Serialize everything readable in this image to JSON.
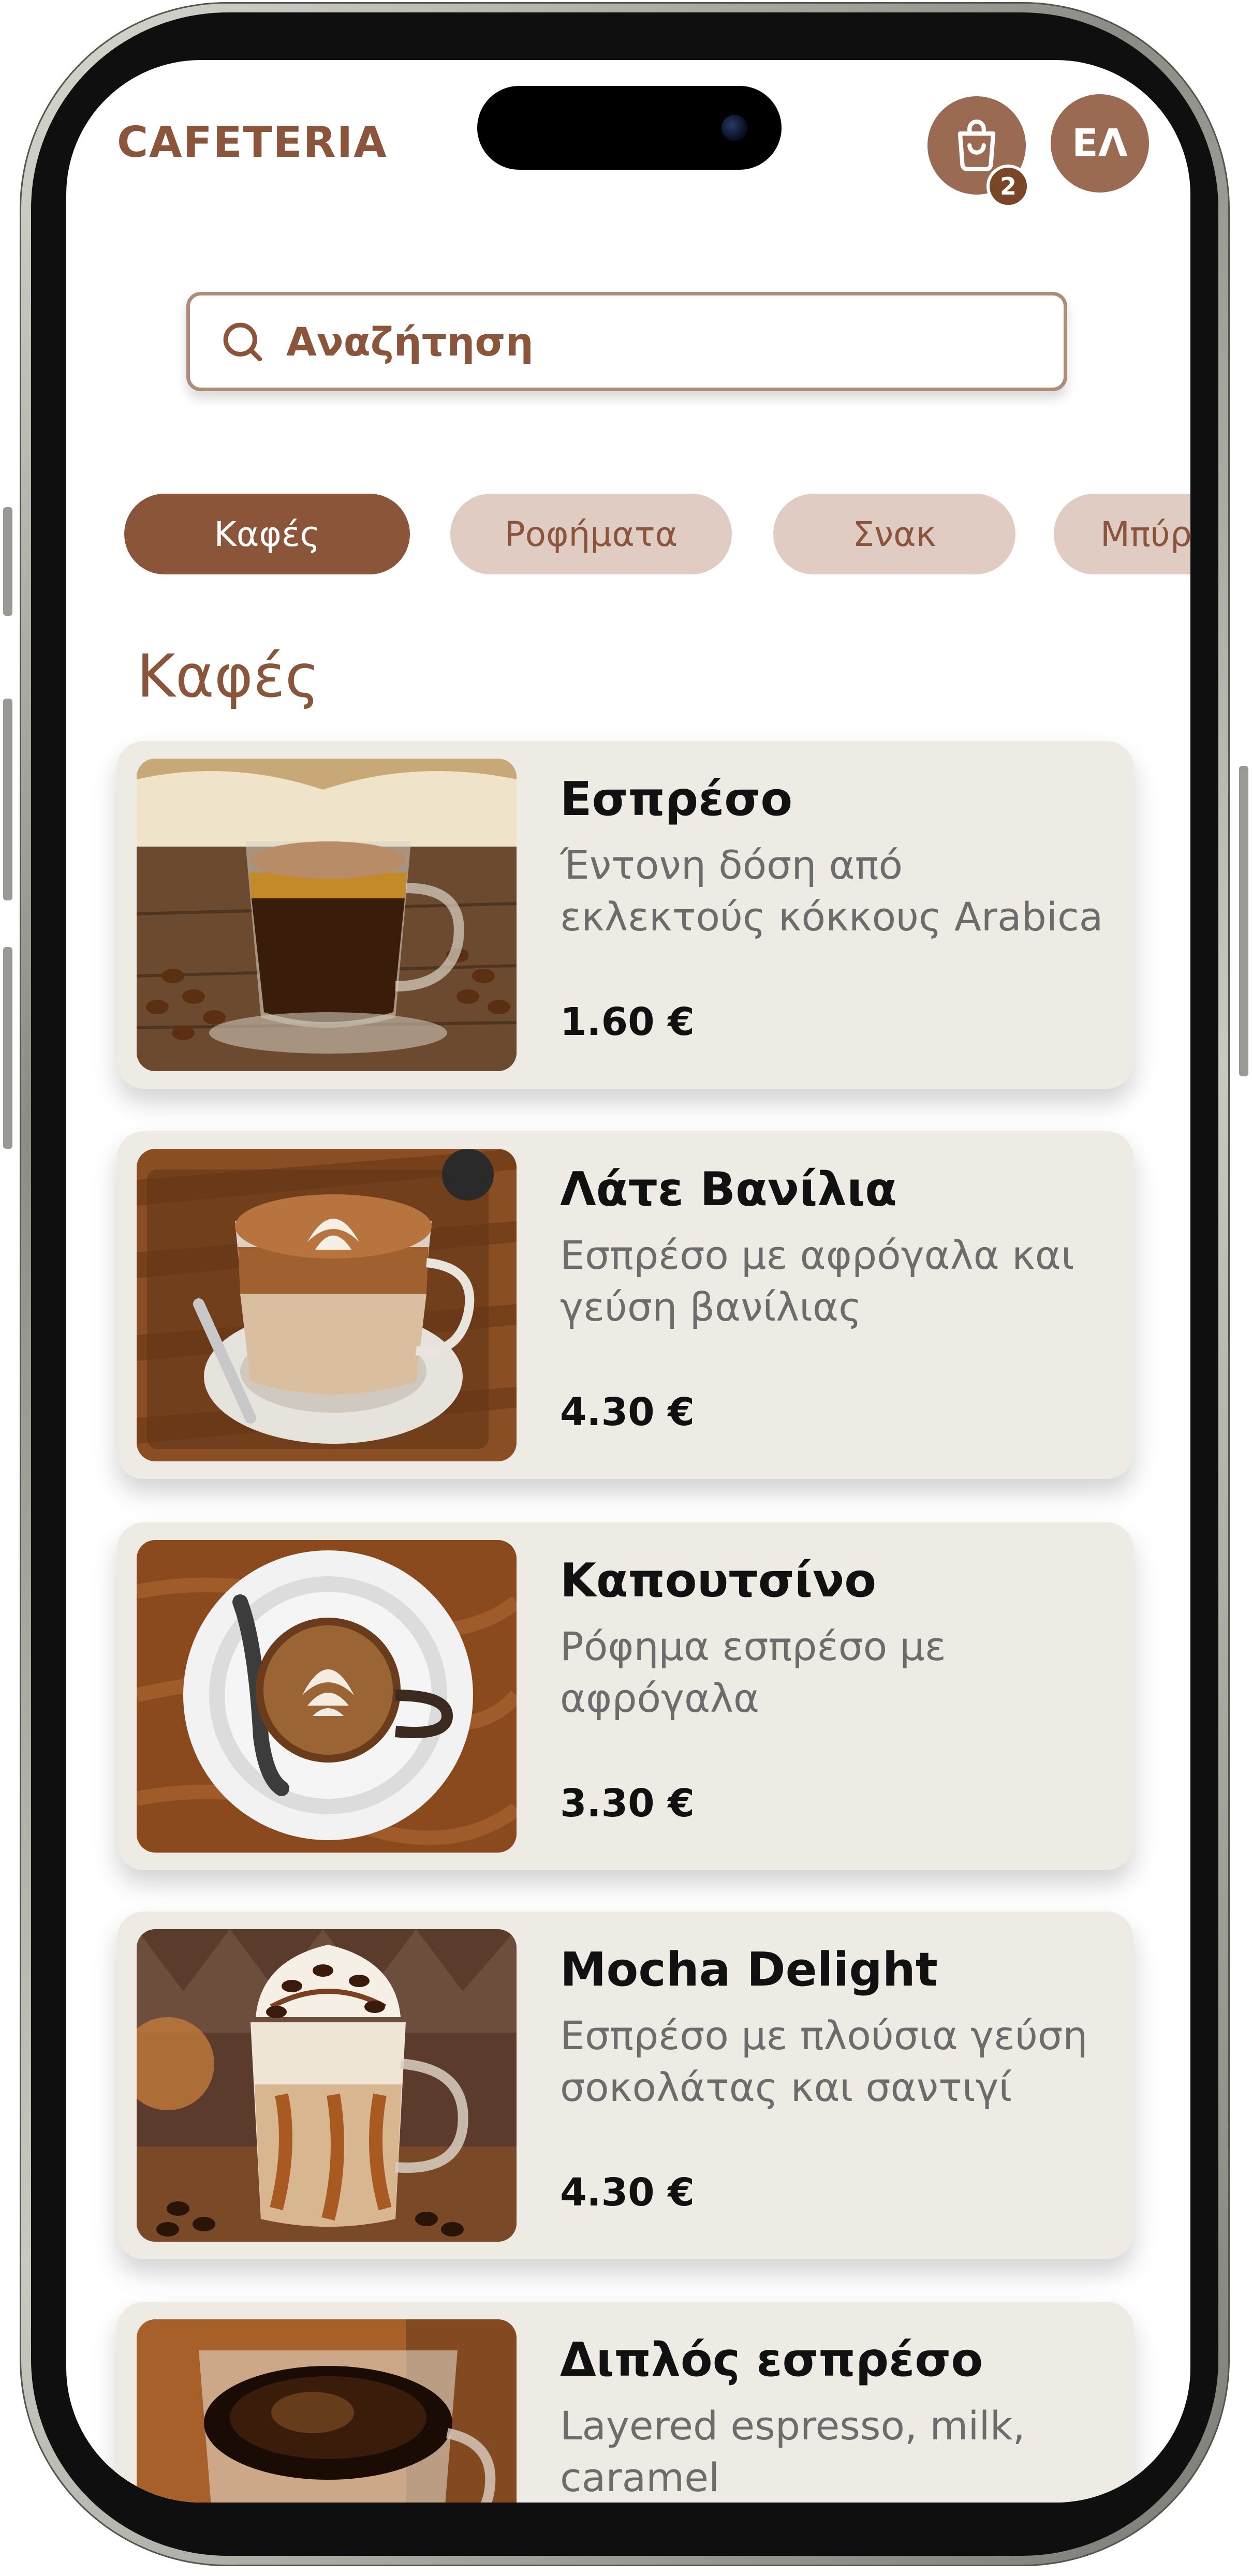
{
  "header": {
    "brand": "CAFETERIA",
    "cart_count": "2",
    "language": "ΕΛ"
  },
  "search": {
    "placeholder": "Αναζήτηση"
  },
  "categories": [
    {
      "label": "Καφές",
      "active": true
    },
    {
      "label": "Ροφήματα",
      "active": false
    },
    {
      "label": "Σνακ",
      "active": false
    },
    {
      "label": "Μπύρες",
      "active": false
    }
  ],
  "section_title": "Καφές",
  "products": [
    {
      "name": "Εσπρέσο",
      "description": "Έντονη δόση από εκλεκτούς κόκκους Arabica",
      "price": "1.60 €"
    },
    {
      "name": "Λάτε Βανίλια",
      "description": "Εσπρέσο με αφρόγαλα και γεύση βανίλιας",
      "price": "4.30 €"
    },
    {
      "name": "Καπουτσίνο",
      "description": "Ρόφημα εσπρέσο με αφρόγαλα",
      "price": "3.30 €"
    },
    {
      "name": "Mocha Delight",
      "description": "Εσπρέσο με πλούσια γεύση σοκολάτας και σαντιγί",
      "price": "4.30 €"
    },
    {
      "name": "Διπλός εσπρέσο",
      "description": "Layered espresso, milk, caramel",
      "price": ""
    }
  ],
  "colors": {
    "brand": "#8a553a",
    "chip_active": "#8b5539",
    "chip_inactive": "#e0ccc3",
    "card_bg": "#eeebe5"
  },
  "icons": {
    "search": "search-icon",
    "cart": "shopping-bag-icon"
  }
}
